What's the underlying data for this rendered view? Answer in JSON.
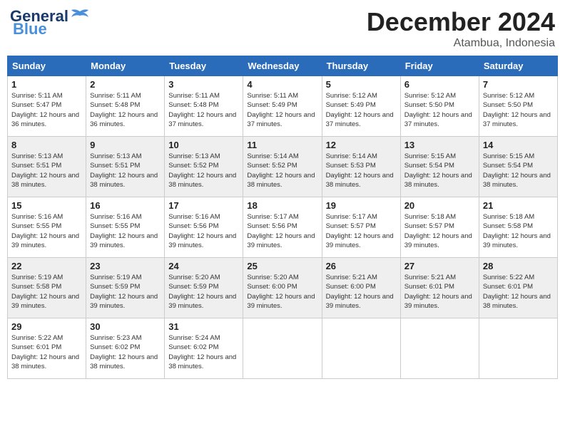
{
  "header": {
    "logo_line1": "General",
    "logo_line2": "Blue",
    "month": "December 2024",
    "location": "Atambua, Indonesia"
  },
  "days_of_week": [
    "Sunday",
    "Monday",
    "Tuesday",
    "Wednesday",
    "Thursday",
    "Friday",
    "Saturday"
  ],
  "weeks": [
    {
      "shade": "odd",
      "days": [
        {
          "num": "1",
          "sunrise": "5:11 AM",
          "sunset": "5:47 PM",
          "daylight": "12 hours and 36 minutes."
        },
        {
          "num": "2",
          "sunrise": "5:11 AM",
          "sunset": "5:48 PM",
          "daylight": "12 hours and 36 minutes."
        },
        {
          "num": "3",
          "sunrise": "5:11 AM",
          "sunset": "5:48 PM",
          "daylight": "12 hours and 37 minutes."
        },
        {
          "num": "4",
          "sunrise": "5:11 AM",
          "sunset": "5:49 PM",
          "daylight": "12 hours and 37 minutes."
        },
        {
          "num": "5",
          "sunrise": "5:12 AM",
          "sunset": "5:49 PM",
          "daylight": "12 hours and 37 minutes."
        },
        {
          "num": "6",
          "sunrise": "5:12 AM",
          "sunset": "5:50 PM",
          "daylight": "12 hours and 37 minutes."
        },
        {
          "num": "7",
          "sunrise": "5:12 AM",
          "sunset": "5:50 PM",
          "daylight": "12 hours and 37 minutes."
        }
      ]
    },
    {
      "shade": "even",
      "days": [
        {
          "num": "8",
          "sunrise": "5:13 AM",
          "sunset": "5:51 PM",
          "daylight": "12 hours and 38 minutes."
        },
        {
          "num": "9",
          "sunrise": "5:13 AM",
          "sunset": "5:51 PM",
          "daylight": "12 hours and 38 minutes."
        },
        {
          "num": "10",
          "sunrise": "5:13 AM",
          "sunset": "5:52 PM",
          "daylight": "12 hours and 38 minutes."
        },
        {
          "num": "11",
          "sunrise": "5:14 AM",
          "sunset": "5:52 PM",
          "daylight": "12 hours and 38 minutes."
        },
        {
          "num": "12",
          "sunrise": "5:14 AM",
          "sunset": "5:53 PM",
          "daylight": "12 hours and 38 minutes."
        },
        {
          "num": "13",
          "sunrise": "5:15 AM",
          "sunset": "5:54 PM",
          "daylight": "12 hours and 38 minutes."
        },
        {
          "num": "14",
          "sunrise": "5:15 AM",
          "sunset": "5:54 PM",
          "daylight": "12 hours and 38 minutes."
        }
      ]
    },
    {
      "shade": "odd",
      "days": [
        {
          "num": "15",
          "sunrise": "5:16 AM",
          "sunset": "5:55 PM",
          "daylight": "12 hours and 39 minutes."
        },
        {
          "num": "16",
          "sunrise": "5:16 AM",
          "sunset": "5:55 PM",
          "daylight": "12 hours and 39 minutes."
        },
        {
          "num": "17",
          "sunrise": "5:16 AM",
          "sunset": "5:56 PM",
          "daylight": "12 hours and 39 minutes."
        },
        {
          "num": "18",
          "sunrise": "5:17 AM",
          "sunset": "5:56 PM",
          "daylight": "12 hours and 39 minutes."
        },
        {
          "num": "19",
          "sunrise": "5:17 AM",
          "sunset": "5:57 PM",
          "daylight": "12 hours and 39 minutes."
        },
        {
          "num": "20",
          "sunrise": "5:18 AM",
          "sunset": "5:57 PM",
          "daylight": "12 hours and 39 minutes."
        },
        {
          "num": "21",
          "sunrise": "5:18 AM",
          "sunset": "5:58 PM",
          "daylight": "12 hours and 39 minutes."
        }
      ]
    },
    {
      "shade": "even",
      "days": [
        {
          "num": "22",
          "sunrise": "5:19 AM",
          "sunset": "5:58 PM",
          "daylight": "12 hours and 39 minutes."
        },
        {
          "num": "23",
          "sunrise": "5:19 AM",
          "sunset": "5:59 PM",
          "daylight": "12 hours and 39 minutes."
        },
        {
          "num": "24",
          "sunrise": "5:20 AM",
          "sunset": "5:59 PM",
          "daylight": "12 hours and 39 minutes."
        },
        {
          "num": "25",
          "sunrise": "5:20 AM",
          "sunset": "6:00 PM",
          "daylight": "12 hours and 39 minutes."
        },
        {
          "num": "26",
          "sunrise": "5:21 AM",
          "sunset": "6:00 PM",
          "daylight": "12 hours and 39 minutes."
        },
        {
          "num": "27",
          "sunrise": "5:21 AM",
          "sunset": "6:01 PM",
          "daylight": "12 hours and 39 minutes."
        },
        {
          "num": "28",
          "sunrise": "5:22 AM",
          "sunset": "6:01 PM",
          "daylight": "12 hours and 38 minutes."
        }
      ]
    },
    {
      "shade": "odd",
      "days": [
        {
          "num": "29",
          "sunrise": "5:22 AM",
          "sunset": "6:01 PM",
          "daylight": "12 hours and 38 minutes."
        },
        {
          "num": "30",
          "sunrise": "5:23 AM",
          "sunset": "6:02 PM",
          "daylight": "12 hours and 38 minutes."
        },
        {
          "num": "31",
          "sunrise": "5:24 AM",
          "sunset": "6:02 PM",
          "daylight": "12 hours and 38 minutes."
        },
        null,
        null,
        null,
        null
      ]
    }
  ]
}
